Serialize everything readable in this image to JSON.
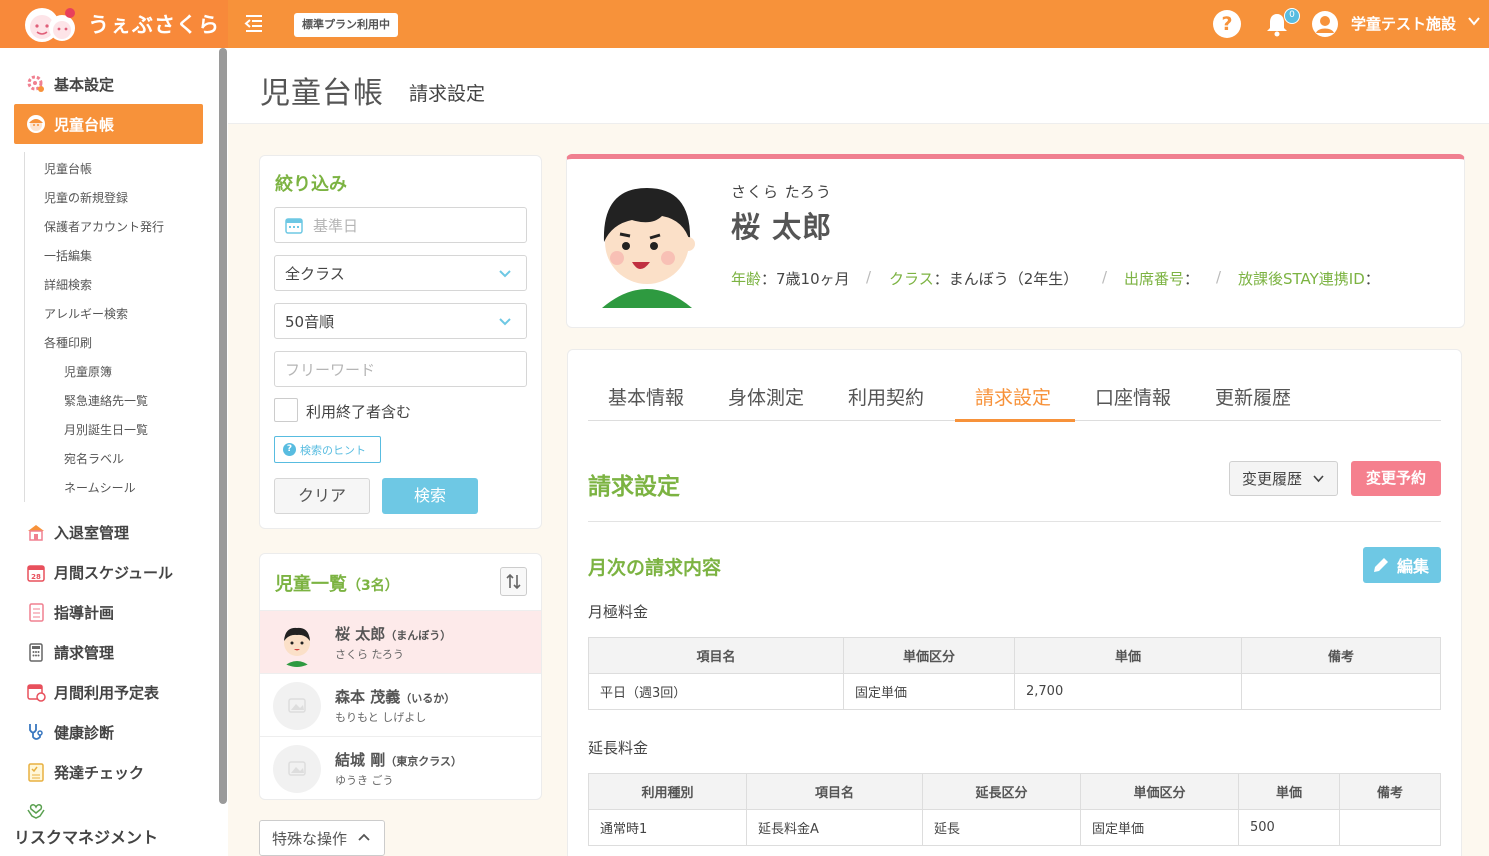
{
  "header": {
    "app_name": "うぇぶさくら",
    "plan": "標準プラン利用中",
    "notifications": "0",
    "facility": "学童テスト施設",
    "brand_color": "#f7923a"
  },
  "sidebar": {
    "items": [
      {
        "label": "基本設定",
        "icon": "gear-icon"
      },
      {
        "label": "児童台帳",
        "icon": "child-face-icon"
      },
      {
        "label": "入退室管理",
        "icon": "school-icon"
      },
      {
        "label": "月間スケジュール",
        "icon": "calendar-icon"
      },
      {
        "label": "指導計画",
        "icon": "notebook-icon"
      },
      {
        "label": "請求管理",
        "icon": "calculator-icon"
      },
      {
        "label": "月間利用予定表",
        "icon": "calendar-clock-icon"
      },
      {
        "label": "健康診断",
        "icon": "stethoscope-icon"
      },
      {
        "label": "発達チェック",
        "icon": "checklist-icon"
      },
      {
        "label": "リスクマネジメント",
        "icon": "hands-heart-icon"
      }
    ],
    "sub_items": [
      "児童台帳",
      "児童の新規登録",
      "保護者アカウント発行",
      "一括編集",
      "詳細検索",
      "アレルギー検索",
      "各種印刷"
    ],
    "print_items": [
      "児童原簿",
      "緊急連絡先一覧",
      "月別誕生日一覧",
      "宛名ラベル",
      "ネームシール"
    ]
  },
  "page": {
    "title": "児童台帳",
    "subtitle": "請求設定"
  },
  "filter": {
    "title": "絞り込み",
    "date_placeholder": "基準日",
    "class_select": "全クラス",
    "order_select": "50音順",
    "keyword_placeholder": "フリーワード",
    "include_ended": "利用終了者含む",
    "hint": "検索のヒント",
    "clear": "クリア",
    "search": "検索"
  },
  "children": {
    "title": "児童一覧",
    "count": "（3名）",
    "list": [
      {
        "name": "桜 太郎",
        "class": "（まんぼう）",
        "kana": "さくら たろう"
      },
      {
        "name": "森本 茂義",
        "class": "（いるか）",
        "kana": "もりもと しげよし"
      },
      {
        "name": "結城 剛",
        "class": "（東京クラス）",
        "kana": "ゆうき ごう"
      }
    ],
    "special_ops": "特殊な操作"
  },
  "profile": {
    "kana": "さくら たろう",
    "name": "桜 太郎",
    "age_label": "年齢",
    "age": "：7歳10ヶ月",
    "class_label": "クラス",
    "class": "：まんぼう（2年生）",
    "attendance_label": "出席番号",
    "attendance": "：",
    "stay_label": "放課後STAY連携ID",
    "stay": "：",
    "sep": "/"
  },
  "tabs": [
    "基本情報",
    "身体測定",
    "利用契約",
    "請求設定",
    "口座情報",
    "更新履歴"
  ],
  "billing": {
    "title": "請求設定",
    "history_button": "変更履歴",
    "reserve_button": "変更予約",
    "monthly_title": "月次の請求内容",
    "edit_button": "編集",
    "monthly_fee": {
      "label": "月極料金",
      "headers": [
        "項目名",
        "単価区分",
        "単価",
        "備考"
      ],
      "rows": [
        [
          "平日（週3回）",
          "固定単価",
          "2,700",
          ""
        ]
      ]
    },
    "extension_fee": {
      "label": "延長料金",
      "headers": [
        "利用種別",
        "項目名",
        "延長区分",
        "単価区分",
        "単価",
        "備考"
      ],
      "rows": [
        [
          "通常時1",
          "延長料金A",
          "延長",
          "固定単価",
          "500",
          ""
        ]
      ]
    }
  }
}
